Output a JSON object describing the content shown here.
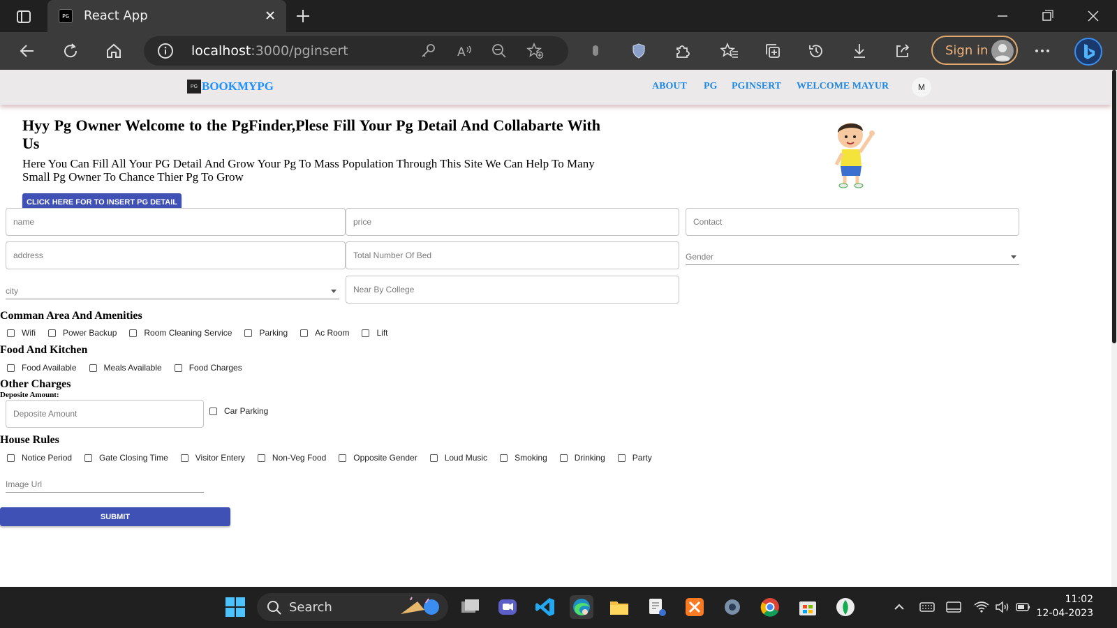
{
  "browser": {
    "tab_title": "React App",
    "tab_favicon_text": "PG",
    "url_host": "localhost",
    "url_rest": ":3000/pginsert",
    "signin_label": "Sign in"
  },
  "navbar": {
    "brand_logo_text": "PG",
    "brand": "BOOKMYPG",
    "links": [
      "ABOUT",
      "PG",
      "PGINSERT",
      "WELCOME MAYUR"
    ],
    "avatar_initial": "M"
  },
  "hero": {
    "title": "Hyy Pg Owner Welcome to the PgFinder,Plese Fill Your Pg Detail And Collabarte With Us",
    "subtitle": "Here You Can Fill All Your PG Detail And Grow Your Pg To Mass Population Through This Site We Can Help To Many Small Pg Owner To Chance Thier Pg To Grow",
    "button": "CLICK HERE FOR TO INSERT PG DETAIL"
  },
  "form": {
    "name_ph": "name",
    "price_ph": "price",
    "contact_ph": "Contact",
    "address_ph": "address",
    "beds_ph": "Total Number Of Bed",
    "gender_ph": "Gender",
    "city_ph": "city",
    "college_ph": "Near By College",
    "amenities_title": "Comman Area And Amenities",
    "amenities": [
      "Wifi",
      "Power Backup",
      "Room Cleaning Service",
      "Parking",
      "Ac Room",
      "Lift"
    ],
    "food_title": "Food And Kitchen",
    "food": [
      "Food Available",
      "Meals Available",
      "Food Charges"
    ],
    "other_title": "Other Charges",
    "deposit_label": "Deposite Amount:",
    "deposit_ph": "Deposite Amount",
    "car_parking": "Car Parking",
    "rules_title": "House Rules",
    "rules": [
      "Notice Period",
      "Gate Closing Time",
      "Visitor Entery",
      "Non-Veg Food",
      "Opposite Gender",
      "Loud Music",
      "Smoking",
      "Drinking",
      "Party"
    ],
    "image_ph": "Image Url",
    "submit": "SUBMIT"
  },
  "taskbar": {
    "search_label": "Search",
    "time": "11:02",
    "date": "12-04-2023"
  },
  "colors": {
    "accent": "#3f51b5",
    "nav_link": "#1e88e5",
    "navbar_bg": "#ece9ea",
    "signin": "#e3a86b"
  }
}
